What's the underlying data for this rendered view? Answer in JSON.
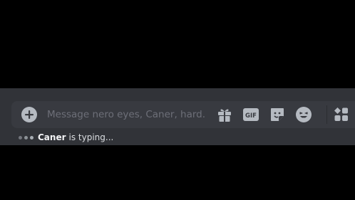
{
  "composer": {
    "placeholder": "Message nero eyes, Caner, hard...",
    "value": "",
    "icons": {
      "add": "add-circle-icon",
      "gift": "gift-icon",
      "gif": "gif-icon",
      "sticker": "sticker-icon",
      "emoji": "emoji-icon",
      "apps": "apps-icon"
    },
    "gif_label": "GIF"
  },
  "typing_indicator": {
    "user": "Caner",
    "text": "is typing..."
  },
  "colors": {
    "background": "#000000",
    "chat_background": "#313338",
    "input_background": "#383a40",
    "icon": "#b5bac1",
    "placeholder": "#6d6f78"
  }
}
